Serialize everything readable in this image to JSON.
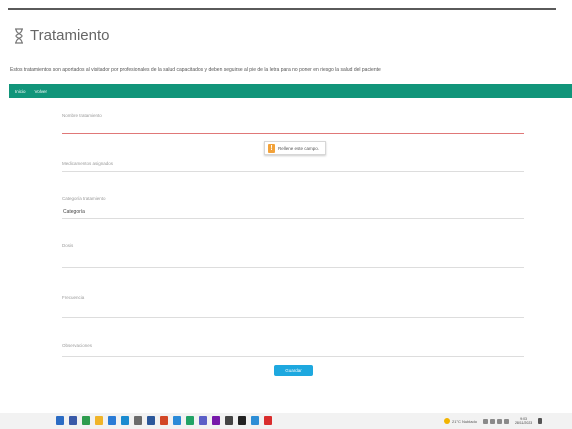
{
  "page": {
    "title": "Tratamiento",
    "description": "Estos tratamientos son aportados al visitador por profesionales de la salud capacitados y deben seguirse al pie de la letra para no poner en riesgo la salud del paciente"
  },
  "nav": {
    "items": [
      "Inicio",
      "Volver"
    ]
  },
  "form": {
    "fields": [
      {
        "label": "Nombre tratamiento",
        "value": ""
      },
      {
        "label": "Medicamentos asignados",
        "value": ""
      },
      {
        "label": "Categoría tratamiento",
        "value": "Categoría"
      },
      {
        "label": "Dosis",
        "value": ""
      },
      {
        "label": "Frecuencia",
        "value": ""
      },
      {
        "label": "Observaciones",
        "value": ""
      }
    ],
    "validation_message": "Rellene este campo.",
    "submit_label": "Guardar"
  },
  "taskbar": {
    "apps": [
      {
        "name": "search-icon",
        "color": "#2b6cc4"
      },
      {
        "name": "task-view-icon",
        "color": "#3a5aa8"
      },
      {
        "name": "chrome-icon",
        "color": "#2e9c4e"
      },
      {
        "name": "explorer-icon",
        "color": "#f0b429"
      },
      {
        "name": "store-icon",
        "color": "#2a7bd6"
      },
      {
        "name": "edge-icon",
        "color": "#1a8bd0"
      },
      {
        "name": "settings-icon",
        "color": "#6b6b6b"
      },
      {
        "name": "word-icon",
        "color": "#2b579a"
      },
      {
        "name": "powerpoint-icon",
        "color": "#d24726"
      },
      {
        "name": "vscode-icon",
        "color": "#2a8ad8"
      },
      {
        "name": "excel-icon",
        "color": "#21a366"
      },
      {
        "name": "teams-icon",
        "color": "#5b5fc7"
      },
      {
        "name": "onenote-icon",
        "color": "#7719aa"
      },
      {
        "name": "notepad-icon",
        "color": "#444444"
      },
      {
        "name": "terminal-icon",
        "color": "#222222"
      },
      {
        "name": "photos-icon",
        "color": "#2d8ed6"
      },
      {
        "name": "opera-icon",
        "color": "#d92d2d"
      }
    ],
    "weather": "21°C Nublado",
    "time": "9:03",
    "date": "28/11/2023",
    "accent": "#11957a",
    "error_color": "#e07878",
    "button_color": "#1ea8df"
  }
}
